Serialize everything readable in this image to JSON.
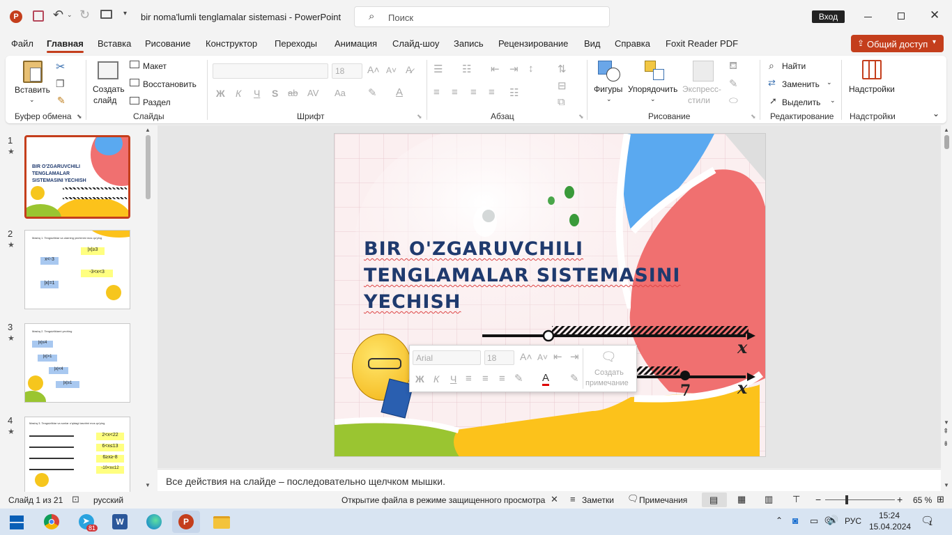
{
  "window": {
    "title": "bir noma'lumli tenglamalar sistemasi  -  PowerPoint",
    "search_placeholder": "Поиск",
    "signin": "Вход"
  },
  "menu": [
    "Файл",
    "Главная",
    "Вставка",
    "Рисование",
    "Конструктор",
    "Переходы",
    "Анимация",
    "Слайд-шоу",
    "Запись",
    "Рецензирование",
    "Вид",
    "Справка",
    "Foxit Reader PDF"
  ],
  "share_label": "Общий доступ",
  "ribbon": {
    "clipboard": {
      "paste": "Вставить",
      "label": "Буфер обмена"
    },
    "slides": {
      "new_slide": "Создать",
      "new_slide2": "слайд",
      "layout": "Макет",
      "reset": "Восстановить",
      "section": "Раздел",
      "label": "Слайды"
    },
    "font": {
      "size": "18",
      "bold": "Ж",
      "italic": "К",
      "underline": "Ч",
      "strike": "S",
      "label": "Шрифт"
    },
    "paragraph": {
      "label": "Абзац"
    },
    "drawing": {
      "shapes": "Фигуры",
      "arrange": "Упорядочить",
      "quick_styles1": "Экспресс-",
      "quick_styles2": "стили",
      "label": "Рисование"
    },
    "editing": {
      "find": "Найти",
      "replace": "Заменить",
      "select": "Выделить",
      "label": "Редактирование"
    },
    "addins": {
      "addins": "Надстройки",
      "label": "Надстройки"
    }
  },
  "thumbnails": [
    {
      "num": "1",
      "star": "★",
      "caption": "BIR O'ZGARUVCHILI TENGLAMALAR SISTEMASINI YECHISH"
    },
    {
      "num": "2",
      "star": "★",
      "caption": "Mashq 1. Tengsizliklar va ularning yechimini mos qo'ying",
      "cells": [
        "|x|≥3",
        "-3<x<3",
        "x<-3",
        "|x|=1"
      ]
    },
    {
      "num": "3",
      "star": "★",
      "caption": "Mashq 2. Tengsizliklarni yeching",
      "cells": [
        "|x|≤4",
        "|x|>1",
        "|x|<4",
        "|x|≥1"
      ]
    },
    {
      "num": "4",
      "star": "★",
      "caption": "Mashq 3. Tengsizliklar va sonlar o'qidagi tasvirini mos qo'ying",
      "cells": [
        "2<x<22",
        "6<x≤13",
        "6≥x≥-8",
        "-10<x≤12"
      ]
    }
  ],
  "slide": {
    "title_lines": [
      "BIR  O'ZGARUVCHILI",
      "TENGLAMALAR SISTEMASINI",
      "YECHISH"
    ],
    "axis_var": "x",
    "axis2_num": "7"
  },
  "mini_toolbar": {
    "font": "Arial",
    "size": "18",
    "bold": "Ж",
    "italic": "К",
    "underline": "Ч",
    "comment1": "Создать",
    "comment2": "примечание"
  },
  "notes": "Все действия на слайде – последовательно щелчком мышки.",
  "status": {
    "slide_of": "Слайд 1 из 21",
    "language": "русский",
    "protected": "Открытие файла в режиме защищенного просмотра",
    "notes_btn": "Заметки",
    "comments_btn": "Примечания",
    "zoom": "65 %"
  },
  "taskbar": {
    "telegram_badge": "81",
    "lang": "РУС",
    "time": "15:24",
    "date": "15.04.2024",
    "notif": "1"
  },
  "colors": {
    "accent": "#c43e1c",
    "title": "#1f3a6e",
    "blue_petal": "#5aa9f0",
    "red_petal": "#f07070",
    "yellow_petal": "#fcc21b",
    "green_petal": "#9ac531"
  }
}
